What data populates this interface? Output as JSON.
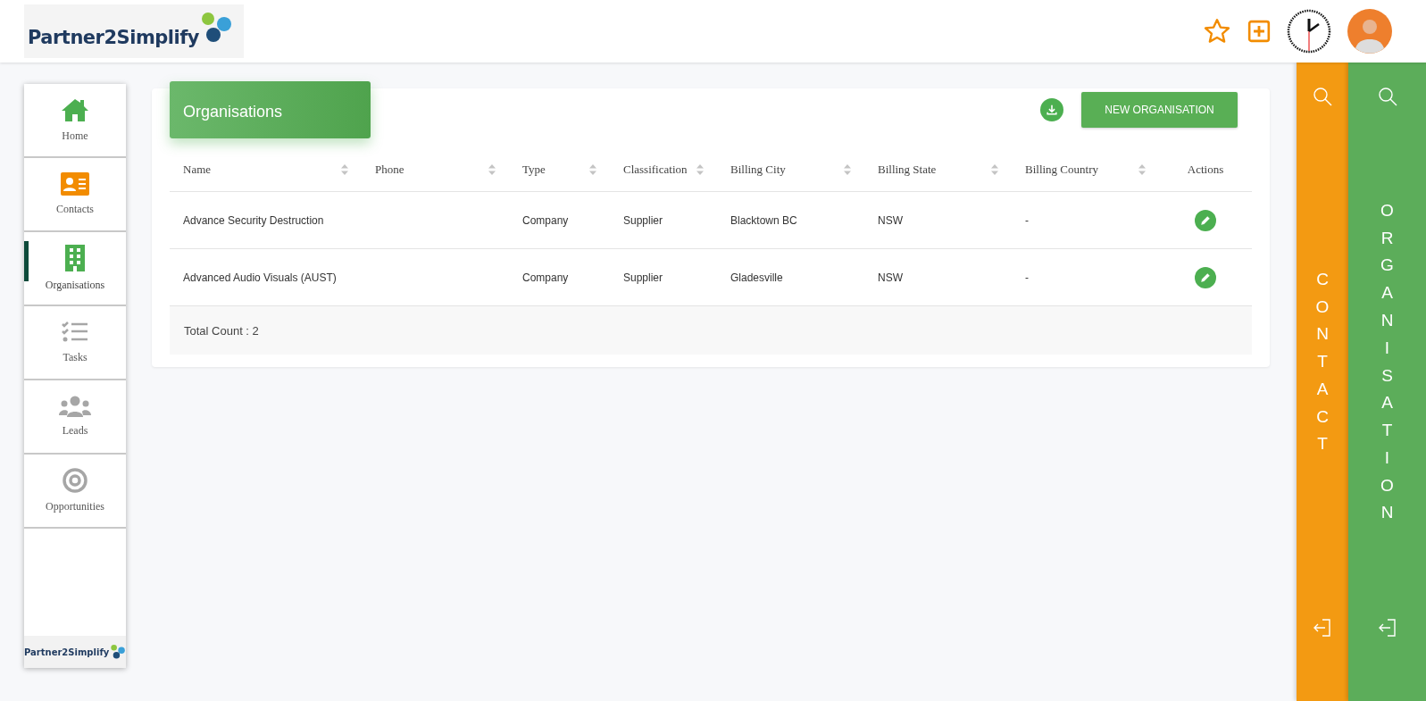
{
  "header": {
    "logo_text": "Partner2Simplify"
  },
  "nav": {
    "items": [
      {
        "label": "Home",
        "selected": false,
        "color": "#4caf50"
      },
      {
        "label": "Contacts",
        "selected": false,
        "color": "#f28c00"
      },
      {
        "label": "Organisations",
        "selected": true,
        "color": "#4caf50"
      },
      {
        "label": "Tasks",
        "selected": false,
        "color": "#a6a6a6"
      },
      {
        "label": "Leads",
        "selected": false,
        "color": "#a6a6a6"
      },
      {
        "label": "Opportunities",
        "selected": false,
        "color": "#a6a6a6"
      }
    ],
    "footer_logo_text": "Partner2Simplify"
  },
  "page": {
    "title": "Organisations",
    "new_button": "NEW ORGANISATION"
  },
  "table": {
    "columns": [
      {
        "label": "Name",
        "sortable": true
      },
      {
        "label": "Phone",
        "sortable": true
      },
      {
        "label": "Type",
        "sortable": true
      },
      {
        "label": "Classification",
        "sortable": true
      },
      {
        "label": "Billing City",
        "sortable": true
      },
      {
        "label": "Billing State",
        "sortable": true
      },
      {
        "label": "Billing Country",
        "sortable": true
      },
      {
        "label": "Actions",
        "sortable": false
      }
    ],
    "rows": [
      {
        "cells": [
          "Advance Security Destruction",
          "",
          "Company",
          "Supplier",
          "Blacktown BC",
          "NSW",
          "-"
        ]
      },
      {
        "cells": [
          "Advanced Audio Visuals (AUST)",
          "",
          "Company",
          "Supplier",
          "Gladesville",
          "NSW",
          "-"
        ]
      }
    ],
    "total": "Total Count : 2"
  },
  "side_panels": [
    {
      "label": "CONTACT",
      "color": "#f39a12"
    },
    {
      "label": "ORGANISATION",
      "color": "#5cad5a"
    }
  ]
}
